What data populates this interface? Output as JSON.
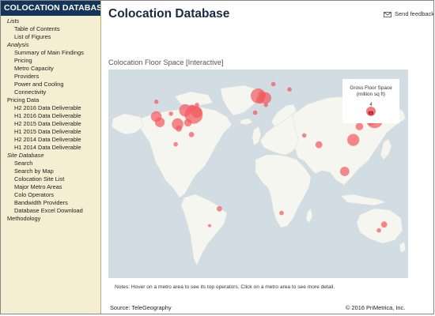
{
  "sidebar": {
    "header": "COLOCATION DATABASE",
    "items": [
      {
        "label": "Lists",
        "kind": "section"
      },
      {
        "label": "Table of Contents",
        "kind": "sub"
      },
      {
        "label": "List of Figures",
        "kind": "sub"
      },
      {
        "label": "Analysis",
        "kind": "section"
      },
      {
        "label": "Summary of Main Findings",
        "kind": "sub"
      },
      {
        "label": "Pricing",
        "kind": "sub"
      },
      {
        "label": "Metro Capacity",
        "kind": "sub"
      },
      {
        "label": "Providers",
        "kind": "sub"
      },
      {
        "label": "Power and Cooling",
        "kind": "sub"
      },
      {
        "label": "Connectivity",
        "kind": "sub"
      },
      {
        "label": "Pricing Data",
        "kind": "top"
      },
      {
        "label": "H2 2016 Data Deliverable",
        "kind": "sub"
      },
      {
        "label": "H1 2016 Data Deliverable",
        "kind": "sub"
      },
      {
        "label": "H2 2015 Data Deliverable",
        "kind": "sub"
      },
      {
        "label": "H1 2015 Data Deliverable",
        "kind": "sub"
      },
      {
        "label": "H2 2014 Data Deliverable",
        "kind": "sub"
      },
      {
        "label": "H1 2014 Data Deliverable",
        "kind": "sub"
      },
      {
        "label": "Site Database",
        "kind": "section"
      },
      {
        "label": "Search",
        "kind": "sub"
      },
      {
        "label": "Search by Map",
        "kind": "sub"
      },
      {
        "label": "Colocation Site List",
        "kind": "sub"
      },
      {
        "label": "Major Metro Areas",
        "kind": "sub"
      },
      {
        "label": "Colo Operators",
        "kind": "sub"
      },
      {
        "label": "Bandwidth Providers",
        "kind": "sub"
      },
      {
        "label": "Database Excel Download",
        "kind": "sub"
      },
      {
        "label": "Methodology",
        "kind": "top"
      }
    ]
  },
  "header": {
    "title": "Colocation Database",
    "feedback_label": "Send feedback",
    "feedback_icon": "envelope-icon"
  },
  "map": {
    "title": "Colocation Floor Space [Interactive]",
    "legend": {
      "title_line1": "Gross Floor Space",
      "title_line2": "(million sq ft)",
      "large_value": "4",
      "small_value": "0.5"
    },
    "colors": {
      "ocean": "#d2dce3",
      "land": "#f6f6f1",
      "bubble": "#f25a60"
    },
    "metros": [
      {
        "lon": -122.4,
        "lat": 37.8,
        "size": 1.2
      },
      {
        "lon": -118.2,
        "lat": 34.0,
        "size": 1.0
      },
      {
        "lon": -122.3,
        "lat": 47.6,
        "size": 0.2
      },
      {
        "lon": -104.9,
        "lat": 39.7,
        "size": 0.2
      },
      {
        "lon": -96.8,
        "lat": 32.8,
        "size": 1.4
      },
      {
        "lon": -95.4,
        "lat": 29.8,
        "size": 0.4
      },
      {
        "lon": -87.6,
        "lat": 41.9,
        "size": 1.6
      },
      {
        "lon": -84.4,
        "lat": 33.7,
        "size": 0.6
      },
      {
        "lon": -77.5,
        "lat": 39.0,
        "size": 3.4
      },
      {
        "lon": -74.0,
        "lat": 40.7,
        "size": 1.3
      },
      {
        "lon": -80.2,
        "lat": 25.8,
        "size": 0.3
      },
      {
        "lon": -79.4,
        "lat": 43.7,
        "size": 0.4
      },
      {
        "lon": -73.6,
        "lat": 45.5,
        "size": 0.2
      },
      {
        "lon": -99.1,
        "lat": 19.4,
        "size": 0.2
      },
      {
        "lon": -46.6,
        "lat": -23.5,
        "size": 0.3
      },
      {
        "lon": -58.4,
        "lat": -34.6,
        "size": 0.1
      },
      {
        "lon": -0.1,
        "lat": 51.5,
        "size": 2.3
      },
      {
        "lon": 8.7,
        "lat": 50.1,
        "size": 1.4
      },
      {
        "lon": 2.35,
        "lat": 48.9,
        "size": 0.6
      },
      {
        "lon": 4.9,
        "lat": 52.4,
        "size": 0.5
      },
      {
        "lon": 18.1,
        "lat": 59.3,
        "size": 0.2
      },
      {
        "lon": -3.7,
        "lat": 40.4,
        "size": 0.2
      },
      {
        "lon": 9.2,
        "lat": 45.5,
        "size": 0.2
      },
      {
        "lon": 37.6,
        "lat": 55.8,
        "size": 0.2
      },
      {
        "lon": 55.3,
        "lat": 25.3,
        "size": 0.2
      },
      {
        "lon": 72.9,
        "lat": 19.1,
        "size": 0.5
      },
      {
        "lon": 28.0,
        "lat": -26.2,
        "size": 0.2
      },
      {
        "lon": 103.8,
        "lat": 1.35,
        "size": 0.9
      },
      {
        "lon": 114.2,
        "lat": 22.3,
        "size": 1.5
      },
      {
        "lon": 121.5,
        "lat": 31.2,
        "size": 0.6
      },
      {
        "lon": 116.4,
        "lat": 39.9,
        "size": 0.4
      },
      {
        "lon": 126.98,
        "lat": 37.57,
        "size": 0.8
      },
      {
        "lon": 139.7,
        "lat": 35.7,
        "size": 3.0
      },
      {
        "lon": 135.5,
        "lat": 34.7,
        "size": 0.7
      },
      {
        "lon": 151.2,
        "lat": -33.9,
        "size": 0.4
      },
      {
        "lon": 144.96,
        "lat": -37.8,
        "size": 0.2
      }
    ]
  },
  "notes": "Notes: Hover on a metro area to see its top operators. Click on a metro area to see more detail.",
  "footer": {
    "source": "Source: TeleGeography",
    "copyright": "© 2016 PriMetrica, Inc."
  }
}
